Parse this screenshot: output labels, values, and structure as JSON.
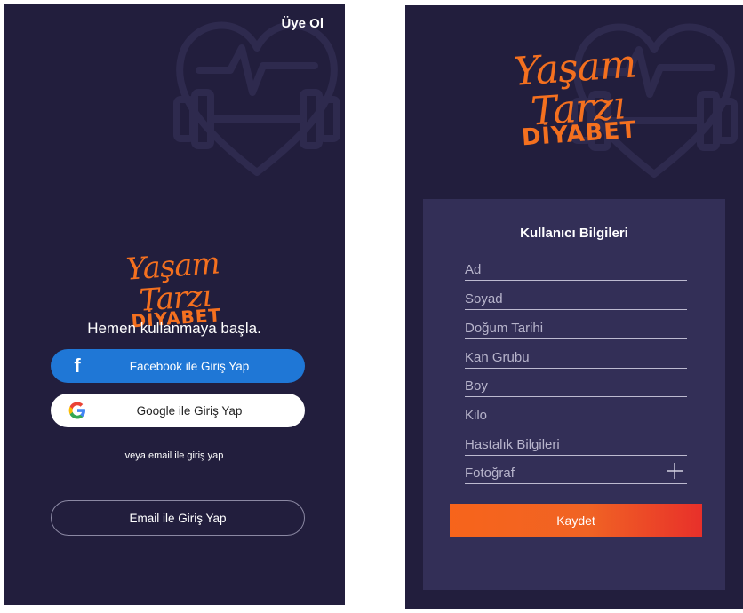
{
  "left_screen": {
    "signup_link": "Üye Ol",
    "logo": {
      "script_text": "Yaşam Tarzı",
      "word_text": "DİYABET"
    },
    "tagline": "Hemen kullanmaya başla.",
    "facebook_button": {
      "label": "Facebook ile Giriş Yap",
      "icon": "facebook-icon"
    },
    "google_button": {
      "label": "Google ile Giriş Yap",
      "icon": "google-icon"
    },
    "alt_text": "veya email ile giriş yap",
    "email_button": {
      "label": "Email ile Giriş Yap"
    }
  },
  "right_screen": {
    "logo": {
      "script_text": "Yaşam Tarzı",
      "word_text": "DİYABET"
    },
    "form": {
      "title": "Kullanıcı Bilgileri",
      "fields": [
        {
          "label": "Ad"
        },
        {
          "label": "Soyad"
        },
        {
          "label": "Doğum Tarihi"
        },
        {
          "label": "Kan Grubu"
        },
        {
          "label": "Boy"
        },
        {
          "label": "Kilo"
        },
        {
          "label": "Hastalık Bilgileri"
        },
        {
          "label": "Fotoğraf",
          "icon": "plus-icon"
        }
      ],
      "save_button": "Kaydet"
    }
  },
  "colors": {
    "background": "#221e3d",
    "card": "#332f57",
    "accent": "#f4701f",
    "facebook": "#1f77d6",
    "save_gradient_end": "#e8302a"
  }
}
